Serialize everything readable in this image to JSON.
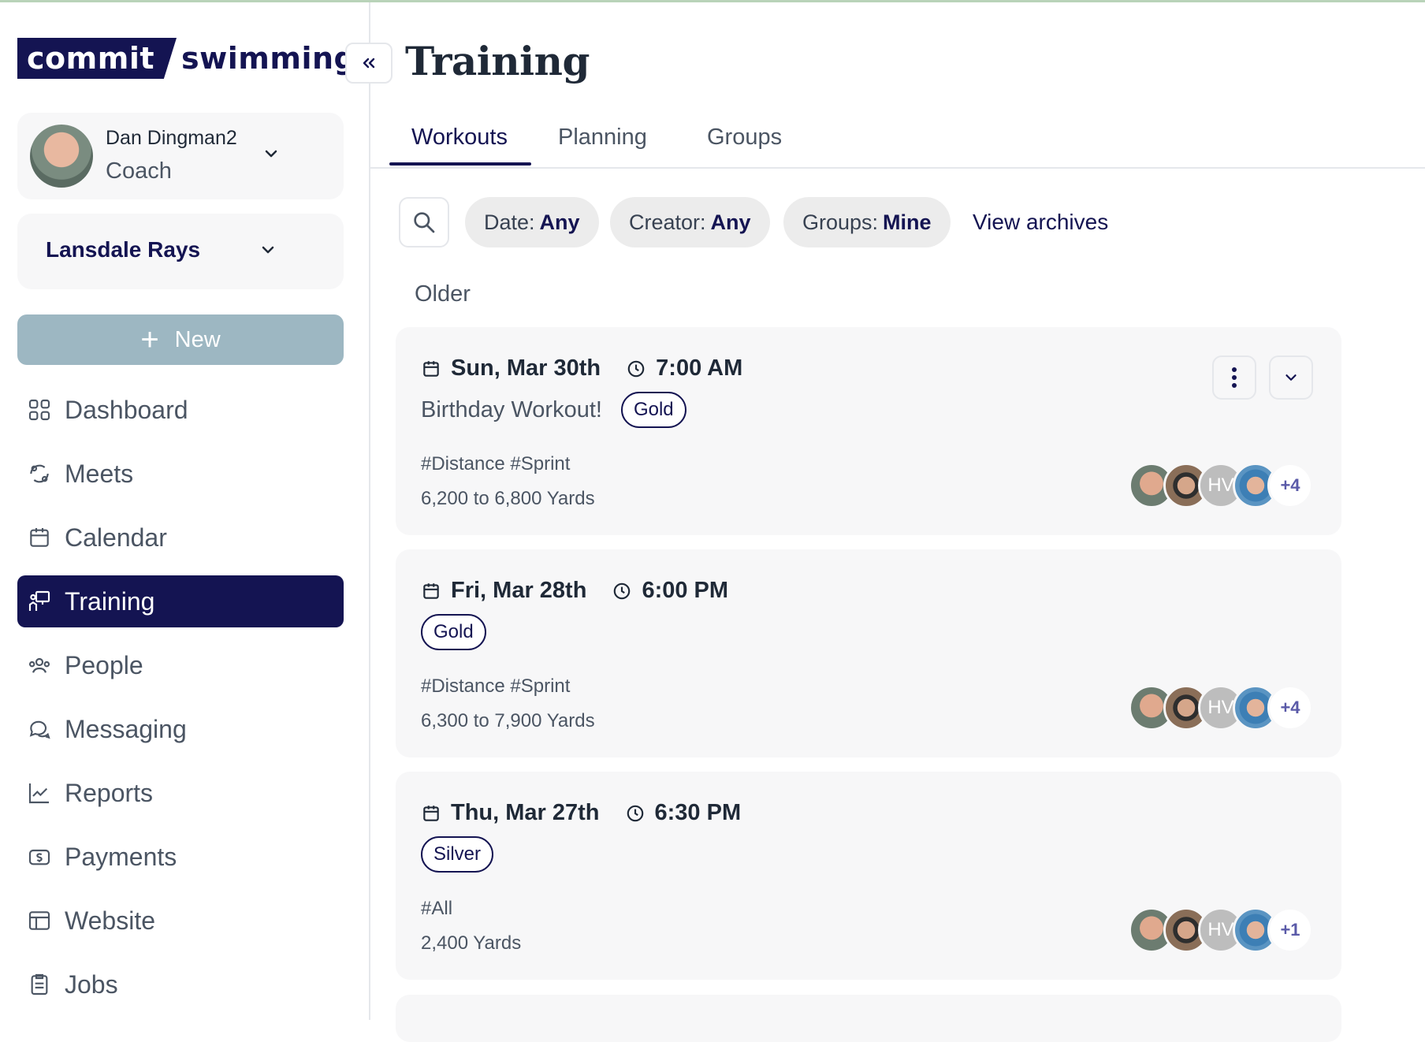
{
  "brand": {
    "part1": "commit",
    "part2": "swimming"
  },
  "user": {
    "name": "Dan Dingman2",
    "role": "Coach"
  },
  "team": {
    "name": "Lansdale Rays"
  },
  "new_button": "New",
  "nav": [
    {
      "label": "Dashboard",
      "icon": "grid-icon",
      "active": false
    },
    {
      "label": "Meets",
      "icon": "meets-icon",
      "active": false
    },
    {
      "label": "Calendar",
      "icon": "calendar-icon",
      "active": false
    },
    {
      "label": "Training",
      "icon": "training-icon",
      "active": true
    },
    {
      "label": "People",
      "icon": "people-icon",
      "active": false
    },
    {
      "label": "Messaging",
      "icon": "chat-icon",
      "active": false
    },
    {
      "label": "Reports",
      "icon": "chart-icon",
      "active": false
    },
    {
      "label": "Payments",
      "icon": "dollar-icon",
      "active": false
    },
    {
      "label": "Website",
      "icon": "website-icon",
      "active": false
    },
    {
      "label": "Jobs",
      "icon": "jobs-icon",
      "active": false
    }
  ],
  "page": {
    "title": "Training"
  },
  "tabs": [
    "Workouts",
    "Planning",
    "Groups"
  ],
  "filters": {
    "date_label": "Date:",
    "date_value": "Any",
    "creator_label": "Creator:",
    "creator_value": "Any",
    "groups_label": "Groups:",
    "groups_value": "Mine",
    "archives": "View archives"
  },
  "section": "Older",
  "workouts": [
    {
      "date": "Sun, Mar 30th",
      "time": "7:00 AM",
      "name": "Birthday Workout!",
      "group": "Gold",
      "tags": "#Distance #Sprint",
      "yards": "6,200 to 6,800 Yards",
      "avatar_initials": "HV",
      "more": "+4"
    },
    {
      "date": "Fri, Mar 28th",
      "time": "6:00 PM",
      "name": "",
      "group": "Gold",
      "tags": "#Distance #Sprint",
      "yards": "6,300 to 7,900 Yards",
      "avatar_initials": "HV",
      "more": "+4"
    },
    {
      "date": "Thu, Mar 27th",
      "time": "6:30 PM",
      "name": "",
      "group": "Silver",
      "tags": "#All",
      "yards": "2,400 Yards",
      "avatar_initials": "HV",
      "more": "+1"
    }
  ],
  "colors": {
    "brand": "#141452",
    "new_button": "#9db7c2",
    "card_bg": "#f7f7f8",
    "pill_bg": "#ececec"
  }
}
